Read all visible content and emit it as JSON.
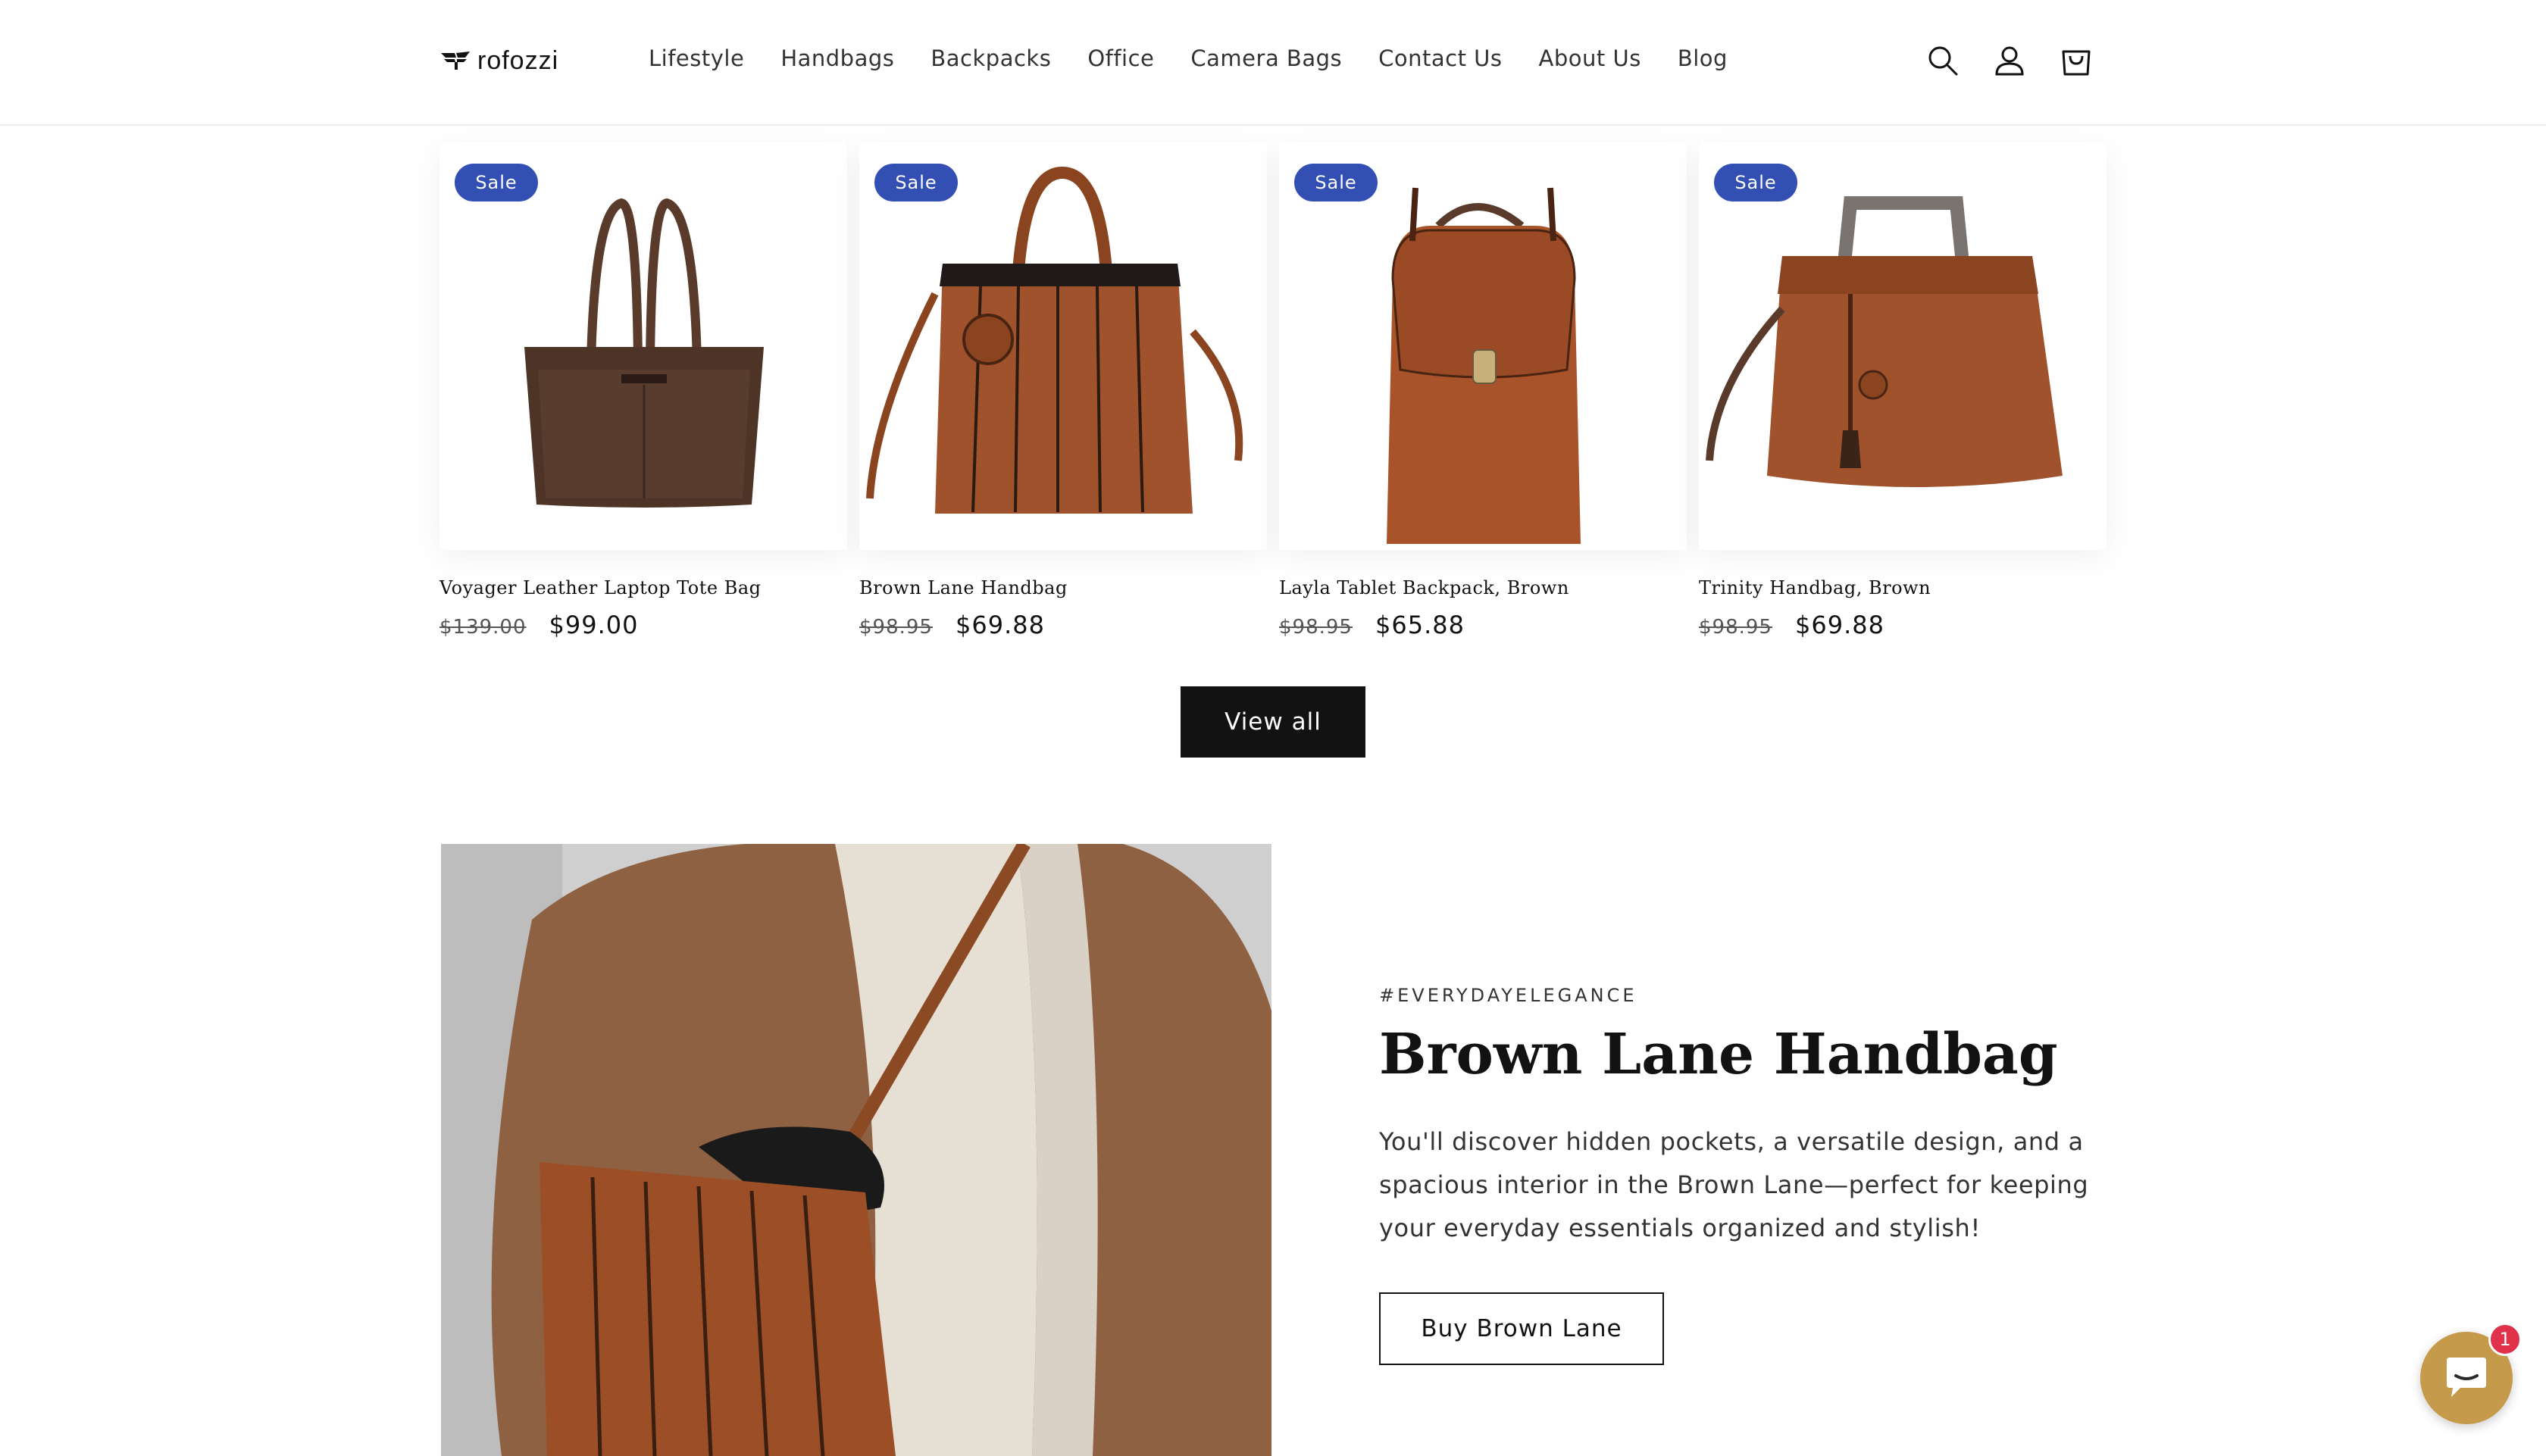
{
  "header": {
    "logo_text": "rofozzi",
    "nav": [
      {
        "label": "Lifestyle"
      },
      {
        "label": "Handbags"
      },
      {
        "label": "Backpacks"
      },
      {
        "label": "Office"
      },
      {
        "label": "Camera Bags"
      },
      {
        "label": "Contact Us"
      },
      {
        "label": "About Us"
      },
      {
        "label": "Blog"
      }
    ],
    "icons": [
      "search-icon",
      "account-icon",
      "cart-icon"
    ]
  },
  "products": [
    {
      "badge": "Sale",
      "title": "Voyager Leather Laptop Tote Bag",
      "price_old": "$139.00",
      "price_new": "$99.00"
    },
    {
      "badge": "Sale",
      "title": "Brown Lane Handbag",
      "price_old": "$98.95",
      "price_new": "$69.88"
    },
    {
      "badge": "Sale",
      "title": "Layla Tablet Backpack, Brown",
      "price_old": "$98.95",
      "price_new": "$65.88"
    },
    {
      "badge": "Sale",
      "title": "Trinity Handbag, Brown",
      "price_old": "$98.95",
      "price_new": "$69.88"
    }
  ],
  "view_all_label": "View all",
  "feature": {
    "tag": "#EVERYDAYELEGANCE",
    "title": "Brown Lane Handbag",
    "description": "You'll discover hidden pockets, a versatile design, and a spacious interior in the Brown Lane—perfect for keeping your everyday essentials organized and stylish!",
    "button_label": "Buy Brown Lane"
  },
  "chat": {
    "badge_count": "1"
  },
  "colors": {
    "sale_badge": "#334fb4",
    "leather_brown": "#a0522d",
    "chat_bg": "#c59a4a",
    "chat_badge": "#e0324a"
  }
}
